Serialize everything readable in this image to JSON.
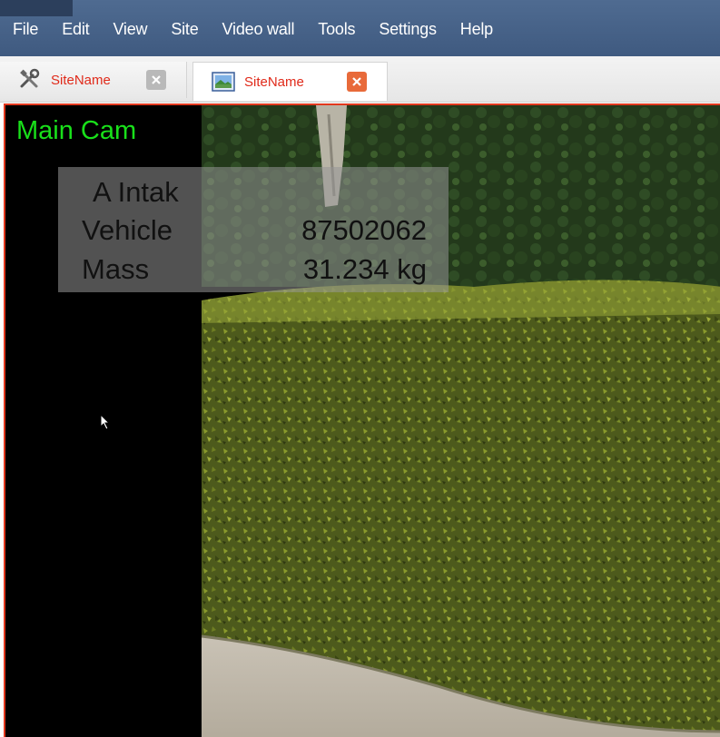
{
  "menu": {
    "items": [
      "File",
      "Edit",
      "View",
      "Site",
      "Video wall",
      "Tools",
      "Settings",
      "Help"
    ]
  },
  "tabs": [
    {
      "label": "SiteName",
      "icon": "tools-icon",
      "active": false
    },
    {
      "label": "SiteName",
      "icon": "picture-icon",
      "active": true
    }
  ],
  "camera": {
    "title": "Main Cam",
    "overlay": {
      "title": "A Intak",
      "rows": [
        {
          "label": "Vehicle",
          "value": "87502062"
        },
        {
          "label": "Mass",
          "value": "31.234 kg"
        }
      ]
    }
  },
  "colors": {
    "menu_bar": "#46628a",
    "tab_text": "#e02a1a",
    "panel_border": "#e2381e",
    "camera_title": "#19e01a",
    "close_active": "#e86a3a"
  }
}
